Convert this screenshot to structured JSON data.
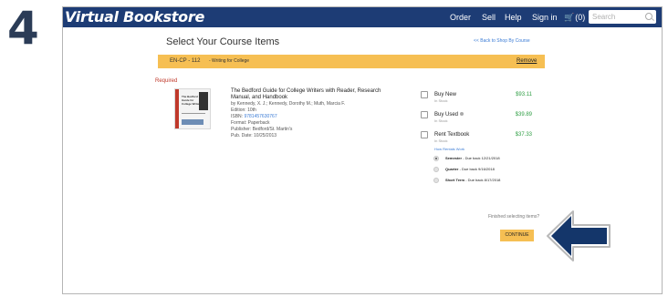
{
  "step": {
    "number": "4"
  },
  "navbar": {
    "brand": "Virtual Bookstore",
    "links": [
      "Order",
      "Sell",
      "Help",
      "Sign in"
    ],
    "cart_count": "(0)",
    "search_placeholder": "Search"
  },
  "header": {
    "title": "Select Your Course Items",
    "back_link": "<< Back to Shop By Course"
  },
  "course": {
    "code": "EN-CP - 112",
    "name": "- Writing for College",
    "remove_label": "Remove"
  },
  "required_label": "Required",
  "book": {
    "cover_lettering": "The Bedford Guide for College Writers",
    "title": "The Bedford Guide for College Writers with Reader, Research Manual, and Handbook",
    "authors": "by Kennedy, X. J.; Kennedy, Dorothy M.; Muth, Marcia F.",
    "edition": "Edition: 10th",
    "isbn_label": "ISBN:",
    "isbn": "9781457630767",
    "format": "Format: Paperback",
    "publisher": "Publisher: Bedford/St. Martin's",
    "pub_date": "Pub. Date: 10/25/2013"
  },
  "options": [
    {
      "label": "Buy New",
      "stock": "In Stock",
      "price": "$93.11"
    },
    {
      "label": "Buy Used",
      "stock": "In Stock",
      "price": "$39.89"
    },
    {
      "label": "Rent Textbook",
      "stock": "In Stock",
      "price": "$37.33"
    }
  ],
  "rental": {
    "how_link": "How Rentals Work",
    "terms": [
      {
        "name": "Semester",
        "due": " - Due back 12/21/2018",
        "selected": true
      },
      {
        "name": "Quarter",
        "due": " - Due back 9/16/2018",
        "selected": false
      },
      {
        "name": "Short Term",
        "due": " - Due back 8/17/2018",
        "selected": false
      }
    ]
  },
  "footer": {
    "finished_prompt": "Finished selecting items?",
    "continue_label": "CONTINUE"
  },
  "colors": {
    "navbar": "#1d3c75",
    "accent": "#f6bf53",
    "price": "#2f9e44",
    "link": "#3a7bd5",
    "required": "#c0392b",
    "arrow": "#14366a"
  }
}
